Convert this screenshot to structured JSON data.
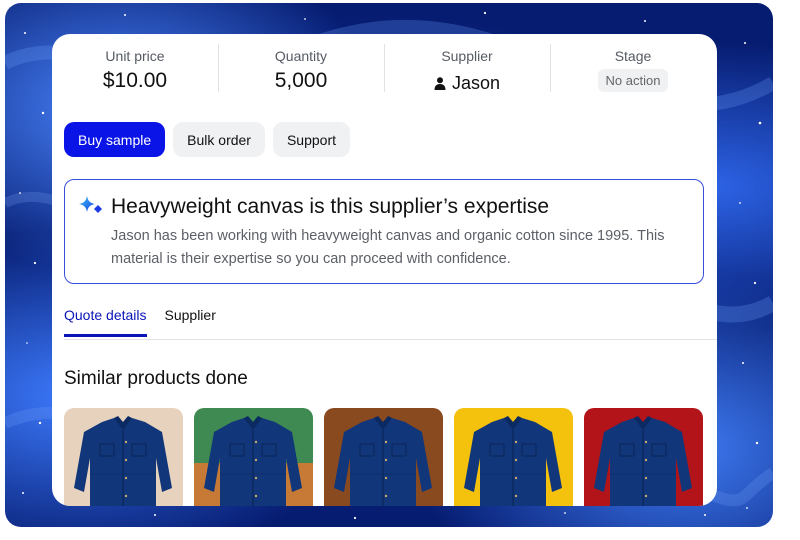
{
  "stats": [
    {
      "label": "Unit price",
      "value": "$10.00"
    },
    {
      "label": "Quantity",
      "value": "5,000"
    },
    {
      "label": "Supplier",
      "value": "Jason",
      "icon": "person-icon"
    },
    {
      "label": "Stage",
      "value": "No action"
    }
  ],
  "actions": {
    "buy_sample": "Buy sample",
    "bulk_order": "Bulk order",
    "support": "Support"
  },
  "insight": {
    "icon": "sparkle-icon",
    "title": "Heavyweight canvas is this supplier’s expertise",
    "body": "Jason has been working with heavyweight canvas and organic cotton since 1995. This material is their expertise so you can proceed with confidence."
  },
  "tabs": [
    {
      "label": "Quote details",
      "active": true
    },
    {
      "label": "Supplier",
      "active": false
    }
  ],
  "similar": {
    "title": "Similar products done",
    "products": [
      {
        "name": "navy-jacket-beige",
        "background": "#e7d3bd",
        "accent": null
      },
      {
        "name": "navy-jacket-green",
        "background": "#3f8a52",
        "accent": "#c77a36"
      },
      {
        "name": "navy-jacket-brown",
        "background": "#8a4a1f",
        "accent": null
      },
      {
        "name": "navy-jacket-yellow",
        "background": "#f4c20d",
        "accent": null
      },
      {
        "name": "navy-jacket-red",
        "background": "#b3141a",
        "accent": null
      }
    ]
  },
  "colors": {
    "primary": "#0a14e6",
    "tab_active": "#0a14b8",
    "insight_border": "#3a4fd8"
  }
}
